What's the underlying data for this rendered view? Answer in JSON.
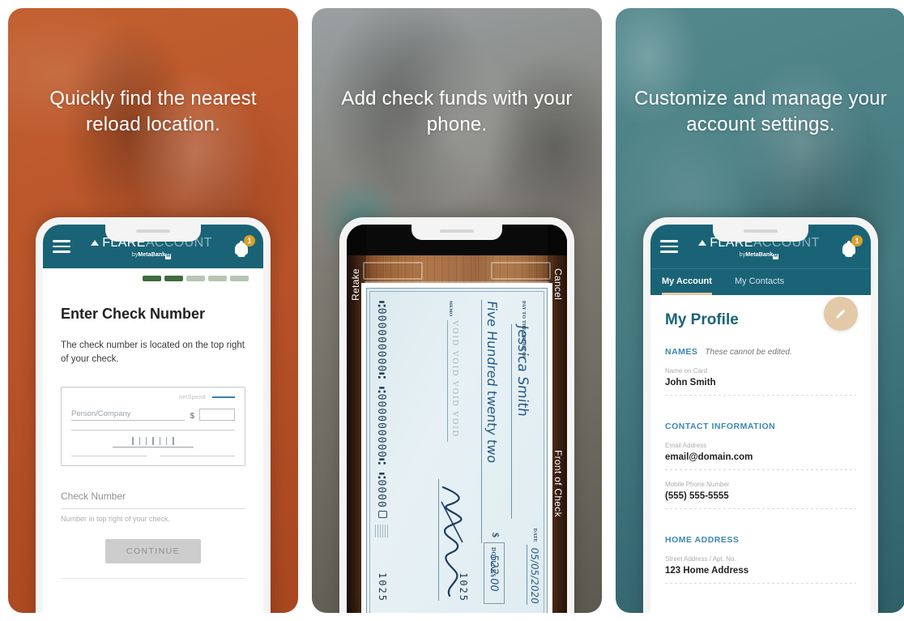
{
  "panels": [
    {
      "headline": "Quickly find the nearest reload location.",
      "accent_color": "#b9532a",
      "app": {
        "brand_primary": "FLARE",
        "brand_secondary": "ACCOUNT",
        "brand_sub_prefix": "by",
        "brand_sub_name": "MetaBank",
        "brand_sub_mark": "Ⓜ",
        "notification_count": "1",
        "menu_icon": "hamburger-menu-icon",
        "bell_icon": "bell-icon"
      },
      "progress": {
        "total": 5,
        "completed": 2
      },
      "screen": {
        "title": "Enter Check Number",
        "description": "The check number is located on the top right of your check.",
        "check_illustration": {
          "brand": "netSpend",
          "payee_placeholder": "Person/Company",
          "dollar_symbol": "$"
        },
        "field": {
          "label": "Check Number",
          "placeholder": "Check Number",
          "value": "",
          "hint": "Number in top right of your check."
        },
        "cta_label": "CONTINUE"
      }
    },
    {
      "headline": "Add check funds with your phone.",
      "accent_color": "#7d7a72",
      "camera": {
        "retake_label": "Retake",
        "cancel_label": "Cancel",
        "side_label": "Front of Check",
        "check": {
          "pay_to_the_order_of": "PAY TO THE ORDER OF",
          "payee": "Jessica Smith",
          "amount_words": "Five Hundred twenty two",
          "dollars_label": "DOLLARS",
          "date_label": "DATE",
          "date": "05/05/2020",
          "amount_symbol": "$",
          "amount": "522.00",
          "memo_label": "MEMO",
          "memo": "VOID VOID VOID VOID",
          "check_number_top": "1025",
          "check_number_bottom": "1025",
          "micr": "⑆000000000⑆  ⑆000000000⑆  ⑆0000"
        }
      }
    },
    {
      "headline": "Customize and manage your account settings.",
      "accent_color": "#447a80",
      "app": {
        "brand_primary": "FLARE",
        "brand_secondary": "ACCOUNT",
        "brand_sub_prefix": "by",
        "brand_sub_name": "MetaBank",
        "brand_sub_mark": "Ⓜ",
        "notification_count": "1",
        "menu_icon": "hamburger-menu-icon",
        "bell_icon": "bell-icon"
      },
      "tabs": [
        {
          "label": "My Account",
          "active": true
        },
        {
          "label": "My Contacts",
          "active": false
        }
      ],
      "screen": {
        "title": "My Profile",
        "edit_icon": "pencil-icon",
        "sections": [
          {
            "title": "NAMES",
            "note": "These cannot be edited.",
            "rows": [
              {
                "label": "Name on Card",
                "value": "John Smith"
              }
            ]
          },
          {
            "title": "CONTACT INFORMATION",
            "note": "",
            "rows": [
              {
                "label": "Email Address",
                "value": "email@domain.com"
              },
              {
                "label": "Mobile Phone Number",
                "value": "(555) 555-5555"
              }
            ]
          },
          {
            "title": "HOME ADDRESS",
            "note": "",
            "rows": [
              {
                "label": "Street Address / Apt. No.",
                "value": "123 Home Address"
              }
            ]
          }
        ]
      }
    }
  ],
  "theme": {
    "header_teal": "#1a6377",
    "badge_gold": "#d8a02a",
    "fab_tan": "#e3c9a8",
    "progress_done": "#3f6b3b",
    "progress_todo": "#b8c5b3",
    "section_blue": "#3d87b5"
  }
}
